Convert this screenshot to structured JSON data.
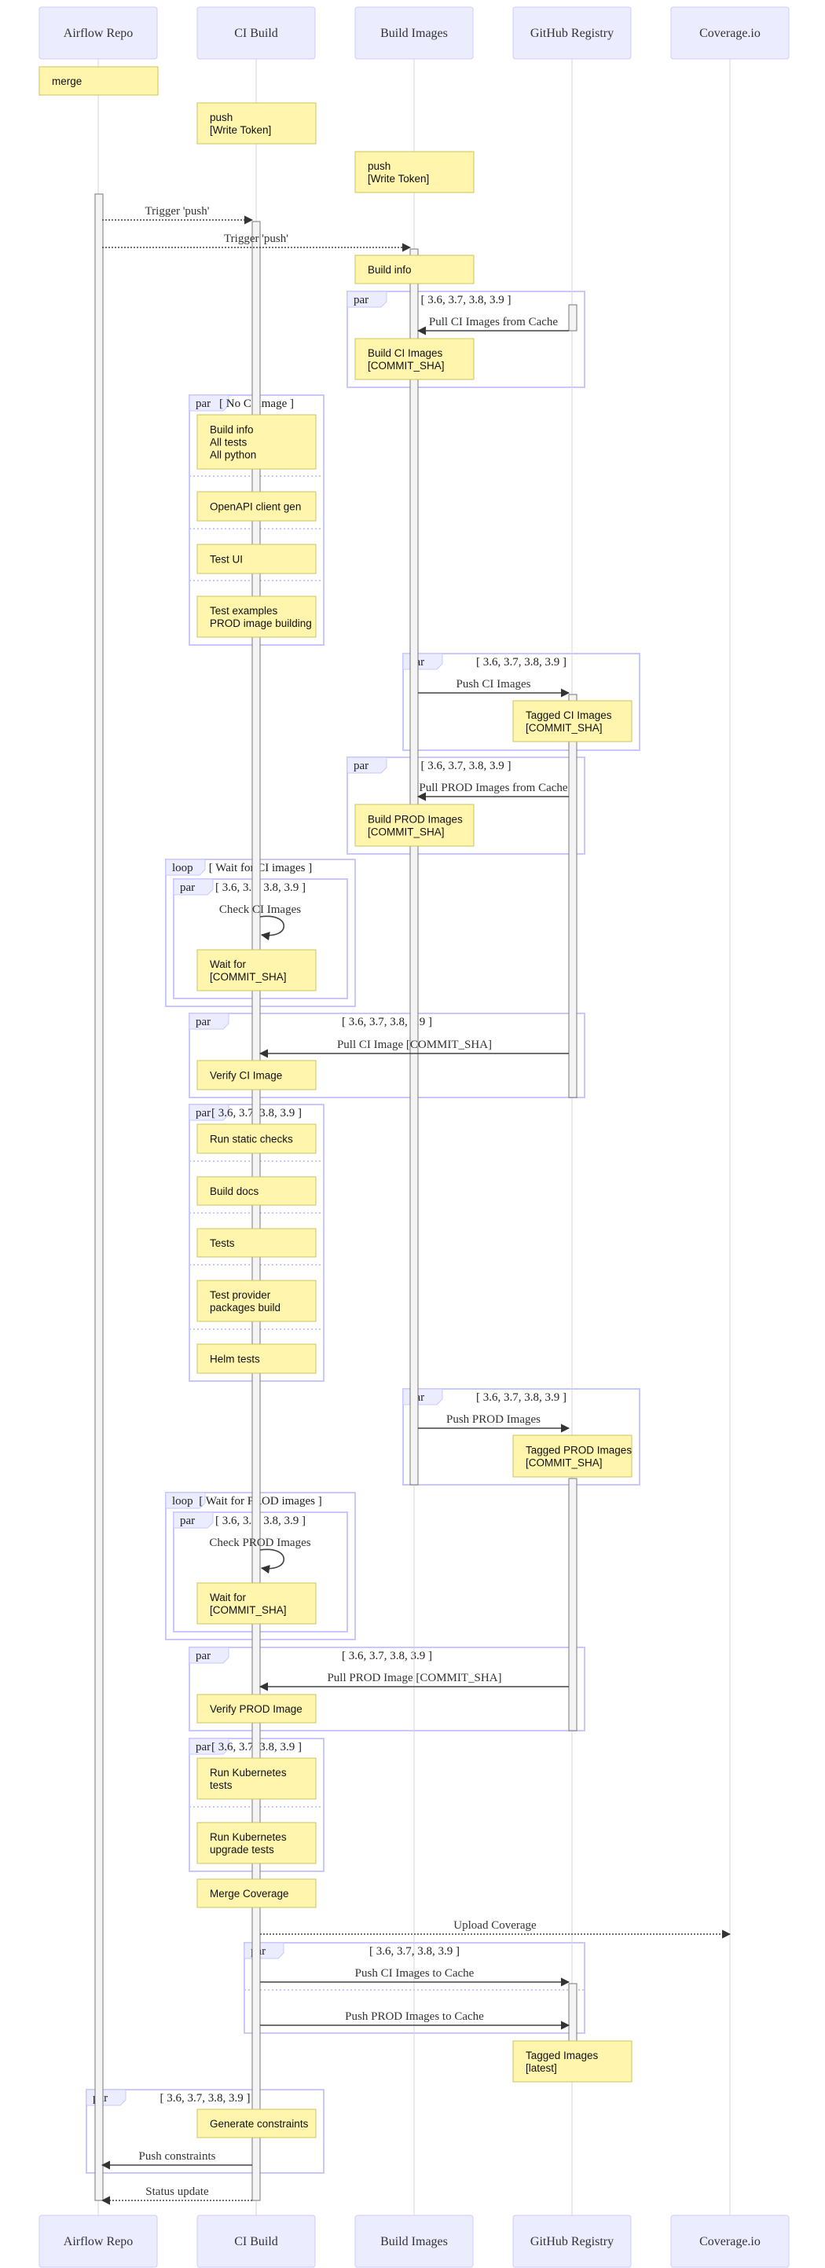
{
  "colors": {
    "actor_fill": "#ECECFF",
    "actor_border": "#CCCCFF",
    "note_fill": "#fff5ad",
    "note_border": "#c9c55e",
    "frame_border": "#c8c8ff",
    "message_line": "#444444"
  },
  "actors": [
    "Airflow Repo",
    "CI Build",
    "Build Images",
    "GitHub Registry",
    "Coverage.io"
  ],
  "notes": [
    {
      "lines": [
        "merge"
      ]
    },
    {
      "lines": [
        "push",
        "[Write Token]"
      ]
    },
    {
      "lines": [
        "push",
        "[Write Token]"
      ]
    },
    {
      "lines": [
        "Build info"
      ]
    },
    {
      "lines": [
        "Build CI Images",
        "[COMMIT_SHA]"
      ]
    },
    {
      "lines": [
        "Build info",
        "All tests",
        "All python"
      ]
    },
    {
      "lines": [
        "OpenAPI client gen"
      ]
    },
    {
      "lines": [
        "Test UI"
      ]
    },
    {
      "lines": [
        "Test examples",
        "PROD image building"
      ]
    },
    {
      "lines": [
        "Tagged CI Images",
        "[COMMIT_SHA]"
      ]
    },
    {
      "lines": [
        "Build PROD Images",
        "[COMMIT_SHA]"
      ]
    },
    {
      "lines": [
        "Wait for",
        "[COMMIT_SHA]"
      ]
    },
    {
      "lines": [
        "Verify CI Image"
      ]
    },
    {
      "lines": [
        "Run static checks"
      ]
    },
    {
      "lines": [
        "Build docs"
      ]
    },
    {
      "lines": [
        "Tests"
      ]
    },
    {
      "lines": [
        "Test provider",
        "packages build"
      ]
    },
    {
      "lines": [
        "Helm tests"
      ]
    },
    {
      "lines": [
        "Tagged PROD Images",
        "[COMMIT_SHA]"
      ]
    },
    {
      "lines": [
        "Wait for",
        "[COMMIT_SHA]"
      ]
    },
    {
      "lines": [
        "Verify PROD Image"
      ]
    },
    {
      "lines": [
        "Run Kubernetes",
        "tests"
      ]
    },
    {
      "lines": [
        "Run Kubernetes",
        "upgrade tests"
      ]
    },
    {
      "lines": [
        "Merge Coverage"
      ]
    },
    {
      "lines": [
        "Tagged Images",
        "[latest]"
      ]
    },
    {
      "lines": [
        "Generate constraints"
      ]
    }
  ],
  "messages": [
    {
      "label": "Trigger 'push'",
      "from": "Airflow Repo",
      "to": "CI Build",
      "style": "dotted"
    },
    {
      "label": "Trigger 'push'",
      "from": "Airflow Repo",
      "to": "Build Images",
      "style": "dotted"
    },
    {
      "label": "Pull CI Images from Cache",
      "from": "GitHub Registry",
      "to": "Build Images",
      "style": "solid"
    },
    {
      "label": "Push CI Images",
      "from": "Build Images",
      "to": "GitHub Registry",
      "style": "solid"
    },
    {
      "label": "Pull PROD Images from Cache",
      "from": "GitHub Registry",
      "to": "Build Images",
      "style": "solid"
    },
    {
      "label": "Check CI Images",
      "from": "CI Build",
      "to": "CI Build",
      "style": "solid"
    },
    {
      "label": "Pull CI Image [COMMIT_SHA]",
      "from": "GitHub Registry",
      "to": "CI Build",
      "style": "solid"
    },
    {
      "label": "Push PROD Images",
      "from": "Build Images",
      "to": "GitHub Registry",
      "style": "solid"
    },
    {
      "label": "Check PROD Images",
      "from": "CI Build",
      "to": "CI Build",
      "style": "solid"
    },
    {
      "label": "Pull PROD Image [COMMIT_SHA]",
      "from": "GitHub Registry",
      "to": "CI Build",
      "style": "solid"
    },
    {
      "label": "Upload Coverage",
      "from": "CI Build",
      "to": "Coverage.io",
      "style": "dotted"
    },
    {
      "label": "Push CI Images to Cache",
      "from": "CI Build",
      "to": "GitHub Registry",
      "style": "solid"
    },
    {
      "label": "Push PROD Images to Cache",
      "from": "CI Build",
      "to": "GitHub Registry",
      "style": "solid"
    },
    {
      "label": "Push constraints",
      "from": "CI Build",
      "to": "Airflow Repo",
      "style": "solid"
    },
    {
      "label": "Status update",
      "from": "CI Build",
      "to": "Airflow Repo",
      "style": "dotted"
    }
  ],
  "frames": [
    {
      "type": "par",
      "condition": "[ 3.6, 3.7, 3.8, 3.9 ]"
    },
    {
      "type": "par",
      "condition": "[ No CI image ]"
    },
    {
      "type": "par",
      "condition": "[ 3.6, 3.7, 3.8, 3.9 ]"
    },
    {
      "type": "par",
      "condition": "[ 3.6, 3.7, 3.8, 3.9 ]"
    },
    {
      "type": "loop",
      "condition": "[ Wait for CI images ]"
    },
    {
      "type": "par",
      "condition": "[ 3.6, 3.7, 3.8, 3.9 ]"
    },
    {
      "type": "par",
      "condition": "[ 3.6, 3.7, 3.8, 3.9 ]"
    },
    {
      "type": "par",
      "condition": "[ 3.6, 3.7, 3.8, 3.9 ]"
    },
    {
      "type": "par",
      "condition": "[ 3.6, 3.7, 3.8, 3.9 ]"
    },
    {
      "type": "loop",
      "condition": "[ Wait for PROD images ]"
    },
    {
      "type": "par",
      "condition": "[ 3.6, 3.7, 3.8, 3.9 ]"
    },
    {
      "type": "par",
      "condition": "[ 3.6, 3.7, 3.8, 3.9 ]"
    },
    {
      "type": "par",
      "condition": "[ 3.6, 3.7, 3.8, 3.9 ]"
    },
    {
      "type": "par",
      "condition": "[ 3.6, 3.7, 3.8, 3.9 ]"
    },
    {
      "type": "par",
      "condition": "[ 3.6, 3.7, 3.8, 3.9 ]"
    }
  ]
}
